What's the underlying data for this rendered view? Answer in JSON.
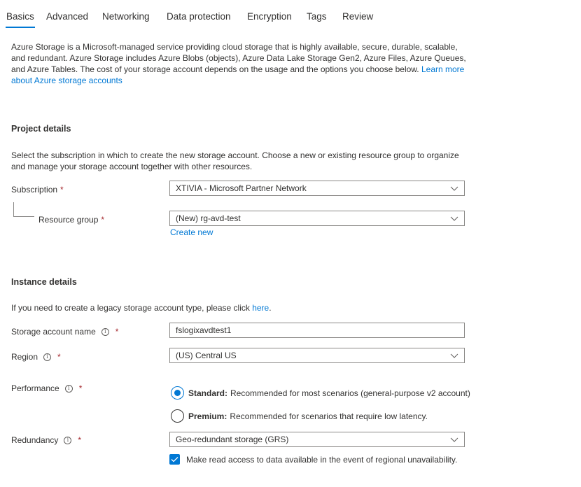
{
  "tabs": [
    {
      "label": "Basics",
      "active": true
    },
    {
      "label": "Advanced",
      "active": false
    },
    {
      "label": "Networking",
      "active": false
    },
    {
      "label": "Data protection",
      "active": false
    },
    {
      "label": "Encryption",
      "active": false
    },
    {
      "label": "Tags",
      "active": false
    },
    {
      "label": "Review",
      "active": false
    }
  ],
  "intro": {
    "text": "Azure Storage is a Microsoft-managed service providing cloud storage that is highly available, secure, durable, scalable, and redundant. Azure Storage includes Azure Blobs (objects), Azure Data Lake Storage Gen2, Azure Files, Azure Queues, and Azure Tables. The cost of your storage account depends on the usage and the options you choose below. ",
    "link": "Learn more about Azure storage accounts"
  },
  "project": {
    "title": "Project details",
    "description": "Select the subscription in which to create the new storage account. Choose a new or existing resource group to organize and manage your storage account together with other resources.",
    "subscription_label": "Subscription",
    "subscription_value": "XTIVIA - Microsoft Partner Network",
    "resource_group_label": "Resource group",
    "resource_group_value": "(New) rg-avd-test",
    "create_new": "Create new"
  },
  "instance": {
    "title": "Instance details",
    "legacy_text": "If you need to create a legacy storage account type, please click ",
    "legacy_link": "here",
    "legacy_period": ".",
    "name_label": "Storage account name",
    "name_value": "fslogixavdtest1",
    "region_label": "Region",
    "region_value": "(US) Central US",
    "performance_label": "Performance",
    "performance_options": [
      {
        "name": "Standard:",
        "desc": "Recommended for most scenarios (general-purpose v2 account)",
        "selected": true
      },
      {
        "name": "Premium:",
        "desc": "Recommended for scenarios that require low latency.",
        "selected": false
      }
    ],
    "redundancy_label": "Redundancy",
    "redundancy_value": "Geo-redundant storage (GRS)",
    "read_access_label": "Make read access to data available in the event of regional unavailability.",
    "read_access_checked": true
  },
  "required_marker": "*",
  "info_glyph": "i",
  "colors": {
    "accent": "#0078d4",
    "required": "#a4262c",
    "border": "#8a8886"
  }
}
